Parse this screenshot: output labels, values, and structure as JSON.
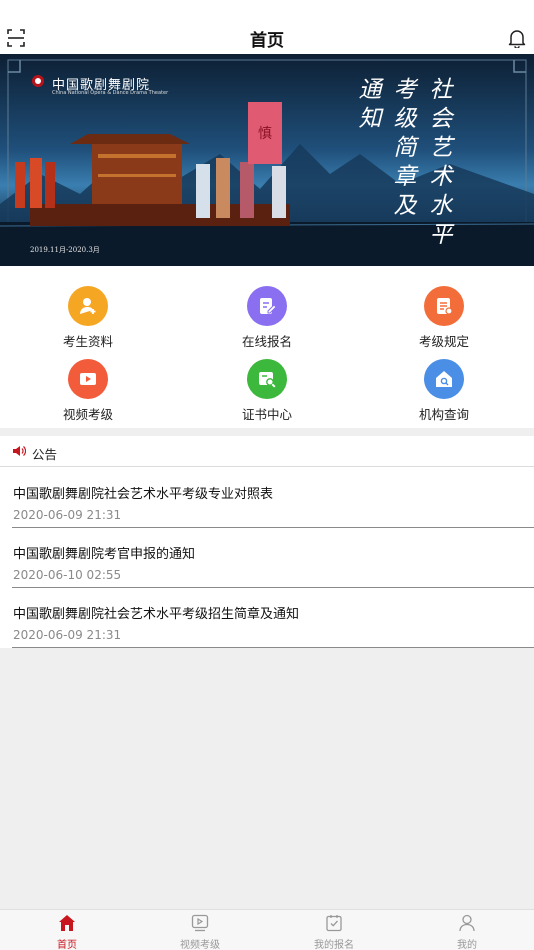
{
  "header": {
    "title": "首页",
    "scan_icon": "scan-icon",
    "bell_icon": "bell-icon"
  },
  "banner": {
    "logo_cn": "中国歌剧舞剧院",
    "logo_en": "China National Opera & Dance Drama Theater",
    "dates": "2019.11月-2020.3月",
    "headline_columns": [
      "社会艺术水平",
      "考级简章及",
      "通知"
    ]
  },
  "features": [
    {
      "label": "考生资料",
      "icon": "user-plus-icon",
      "color": "#f5a623"
    },
    {
      "label": "在线报名",
      "icon": "edit-form-icon",
      "color": "#8a6ff0"
    },
    {
      "label": "考级规定",
      "icon": "document-icon",
      "color": "#f36d3a"
    },
    {
      "label": "视频考级",
      "icon": "video-icon",
      "color": "#f35c3a"
    },
    {
      "label": "证书中心",
      "icon": "certificate-search-icon",
      "color": "#3cb83c"
    },
    {
      "label": "机构查询",
      "icon": "home-building-icon",
      "color": "#4a8ee6"
    }
  ],
  "notice": {
    "title": "公告",
    "items": [
      {
        "title": "中国歌剧舞剧院社会艺术水平考级专业对照表",
        "date": "2020-06-09 21:31"
      },
      {
        "title": "中国歌剧舞剧院考官申报的通知",
        "date": "2020-06-10 02:55"
      },
      {
        "title": "中国歌剧舞剧院社会艺术水平考级招生简章及通知",
        "date": "2020-06-09 21:31"
      }
    ]
  },
  "tabs": [
    {
      "label": "首页",
      "icon": "home-icon",
      "active": true
    },
    {
      "label": "视频考级",
      "icon": "play-video-icon",
      "active": false
    },
    {
      "label": "我的报名",
      "icon": "checkbox-icon",
      "active": false
    },
    {
      "label": "我的",
      "icon": "person-icon",
      "active": false
    }
  ],
  "colors": {
    "accent": "#c8161e",
    "background": "#efefef"
  }
}
